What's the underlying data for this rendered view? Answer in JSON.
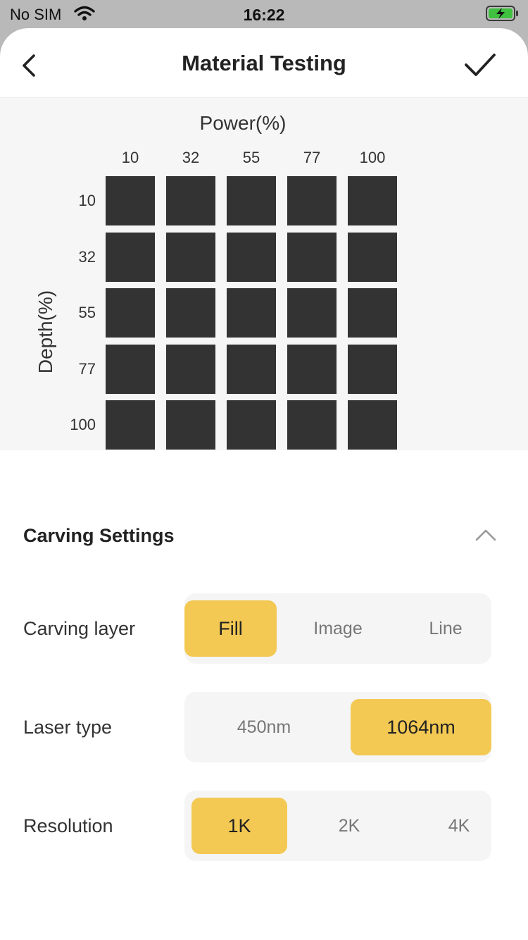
{
  "status_bar": {
    "carrier": "No SIM",
    "time": "16:22",
    "battery_color": "#3fc13f"
  },
  "header": {
    "title": "Material Testing",
    "back_icon": "chevron-left-icon",
    "confirm_icon": "checkmark-icon"
  },
  "preview": {
    "x_axis_label": "Power(%)",
    "y_axis_label": "Depth(%)",
    "columns": [
      "10",
      "32",
      "55",
      "77",
      "100"
    ],
    "rows": [
      "10",
      "32",
      "55",
      "77",
      "100"
    ],
    "cell_color": "#333333"
  },
  "settings": {
    "section_title": "Carving Settings",
    "collapse_icon": "chevron-up-icon",
    "carving_layer": {
      "label": "Carving layer",
      "options": [
        "Fill",
        "Image",
        "Line"
      ],
      "selected": "Fill"
    },
    "laser_type": {
      "label": "Laser type",
      "options": [
        "450nm",
        "1064nm"
      ],
      "selected": "1064nm"
    },
    "resolution": {
      "label": "Resolution",
      "options": [
        "1K",
        "2K",
        "4K"
      ],
      "selected": "1K"
    },
    "accent_color": "#f3c954"
  }
}
